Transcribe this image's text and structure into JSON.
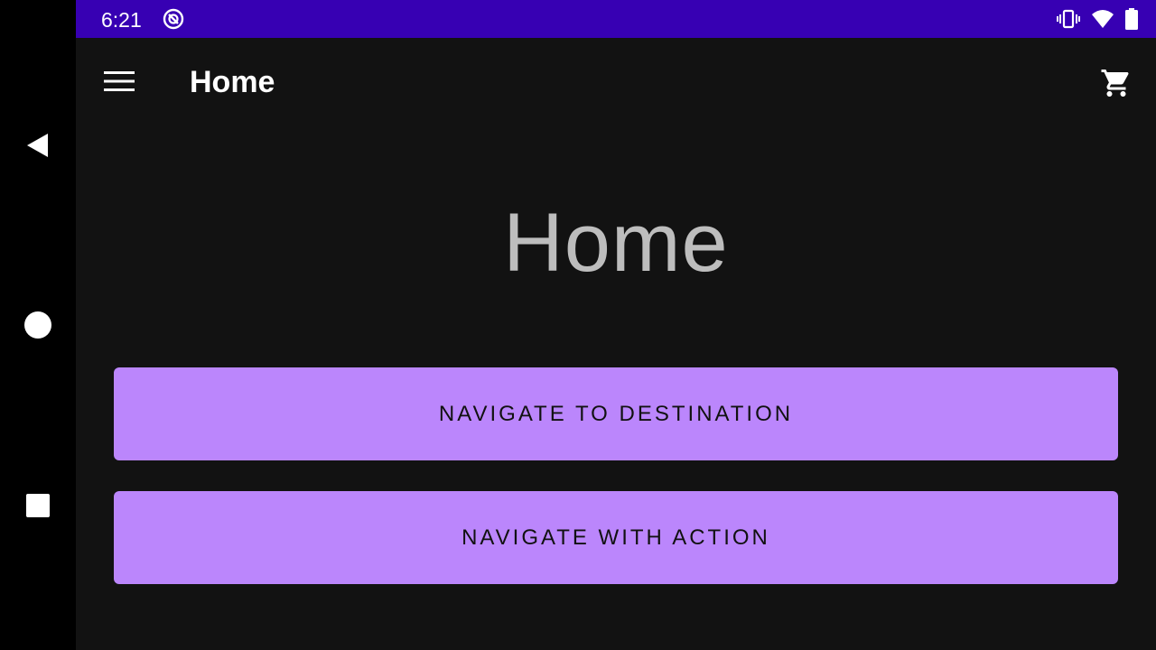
{
  "status_bar": {
    "time": "6:21",
    "icons": [
      "app-notification-icon",
      "vibrate-icon",
      "wifi-icon",
      "battery-icon"
    ]
  },
  "app_bar": {
    "title": "Home",
    "icons": [
      "menu-icon",
      "cart-icon"
    ]
  },
  "content": {
    "heading": "Home",
    "buttons": [
      {
        "label": "NAVIGATE TO DESTINATION"
      },
      {
        "label": "NAVIGATE WITH ACTION"
      }
    ]
  },
  "system_nav": {
    "icons": [
      "back-icon",
      "home-icon",
      "recents-icon"
    ]
  },
  "colors": {
    "status_bar": "#3700b3",
    "background": "#121212",
    "button": "#bb86fc",
    "heading_text": "#bdbdbd"
  }
}
